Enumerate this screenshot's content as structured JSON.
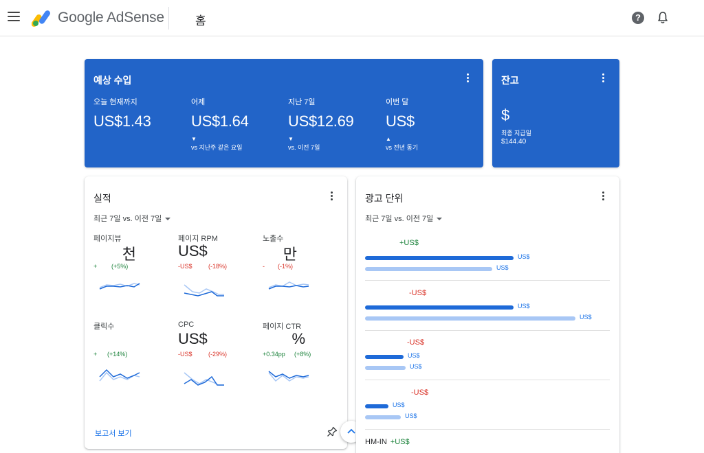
{
  "header": {
    "brand": "Google AdSense",
    "page_title": "홈"
  },
  "colors": {
    "primary_blue": "#2264c8",
    "positive": "#188038",
    "negative": "#d93025",
    "link": "#1a73e8"
  },
  "earnings": {
    "title": "예상 수입",
    "metrics": [
      {
        "label": "오늘 현재까지",
        "value": "US$1.43",
        "arrow": "",
        "compare": ""
      },
      {
        "label": "어제",
        "value": "US$1.64",
        "arrow": "▼",
        "compare": "vs 지난주 같은 요일"
      },
      {
        "label": "지난 7일",
        "value": "US$12.69",
        "arrow": "▼",
        "compare": "vs. 이전 7일"
      },
      {
        "label": "이번 달",
        "value": "US$",
        "arrow": "▲",
        "compare": "vs 전년 동기"
      }
    ]
  },
  "balance": {
    "title": "잔고",
    "amount": "$",
    "last_payment_label": "최종 지급일",
    "last_payment_value": "$144.40"
  },
  "performance": {
    "title": "실적",
    "period": "최근 7일 vs. 이전 7일",
    "metrics": [
      {
        "label": "페이지뷰",
        "value": "천",
        "change_abs": "+",
        "change_pct": "(+5%)",
        "trend": "positive"
      },
      {
        "label": "페이지 RPM",
        "value": "US$",
        "change_abs": "-US$",
        "change_pct": "(-18%)",
        "trend": "negative"
      },
      {
        "label": "노출수",
        "value": "만",
        "change_abs": "-",
        "change_pct": "(-1%)",
        "trend": "negative"
      },
      {
        "label": "클릭수",
        "value": "",
        "change_abs": "+",
        "change_pct": "(+14%)",
        "trend": "positive"
      },
      {
        "label": "CPC",
        "value": "US$",
        "change_abs": "-US$",
        "change_pct": "(-29%)",
        "trend": "negative"
      },
      {
        "label": "페이지 CTR",
        "value": "%",
        "change_abs": "+0.34pp",
        "change_pct": "(+8%)",
        "trend": "positive"
      }
    ],
    "report_link": "보고서 보기"
  },
  "ad_units": {
    "title": "광고 단위",
    "period": "최근 7일 vs. 이전 7일",
    "units": [
      {
        "name": "",
        "change": "+US$",
        "trend": "positive",
        "current_label": "US$",
        "previous_label": "US$",
        "current_ratio": 0.7,
        "previous_ratio": 0.6
      },
      {
        "name": "",
        "change": "-US$",
        "trend": "negative",
        "current_label": "US$",
        "previous_label": "US$",
        "current_ratio": 0.7,
        "previous_ratio": 1.0
      },
      {
        "name": "",
        "change": "-US$",
        "trend": "negative",
        "current_label": "US$",
        "previous_label": "US$",
        "current_ratio": 0.18,
        "previous_ratio": 0.19
      },
      {
        "name": "",
        "change": "-US$",
        "trend": "negative",
        "current_label": "US$",
        "previous_label": "US$",
        "current_ratio": 0.11,
        "previous_ratio": 0.16
      },
      {
        "name": "HM-IN",
        "change": "+US$",
        "trend": "positive",
        "current_label": "",
        "previous_label": "",
        "current_ratio": 0,
        "previous_ratio": 0
      }
    ]
  }
}
